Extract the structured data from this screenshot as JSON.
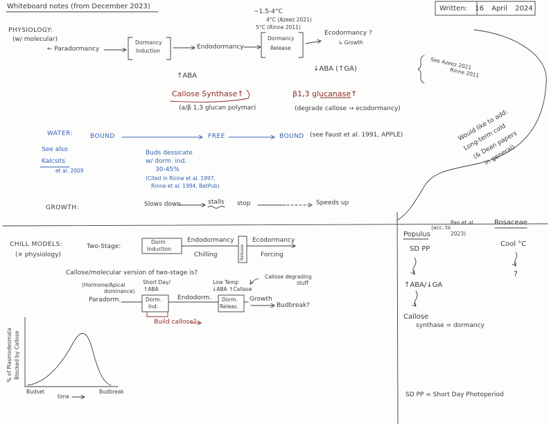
{
  "header": {
    "title": "Whiteboard notes (from December 2023)",
    "written": "Written: 16 April 2024"
  },
  "temps": {
    "range": "~1.5-4°C",
    "azeez": "4°C (Azeez 2021)",
    "rinne": "5°C (Rinne 2011)"
  },
  "physiology": {
    "label": "PHYSIOLOGY:",
    "sub": "(w/ molecular)",
    "paradormancy": "← Paradormancy",
    "induction_1": "Dormancy",
    "induction_2": "Induction",
    "endodormancy": "Endodormancy",
    "release_1": "Dormancy",
    "release_2": "Release",
    "ecodormancy": "Ecodormancy ?",
    "growth": "↳ Growth",
    "aba_up": "↑ABA",
    "aba_down": "↓ABA (↑GA)",
    "callose": "Callose Synthase↑",
    "callose_note": "(a/β 1,3 glucan polymar)",
    "glucanase": "β1,3 glucanase↑",
    "glucanase_note": "(degrade callose → ecodormancy)"
  },
  "refs": {
    "azeez": "See Azeez 2021",
    "rinne": "Rinne 2011"
  },
  "wishlist": {
    "line1": "Would like to add:",
    "line2": "Long-term cold",
    "line3": "(& Dean papers",
    "line4": "in general)"
  },
  "water": {
    "label": "WATER:",
    "bound1": "BOUND",
    "free": "FREE",
    "bound2": "BOUND",
    "faust": "(see Faust et al. 1991, APPLE)",
    "see_also": "See also",
    "kalcsits": "Kalcsits",
    "kalcsits_year": "et al. 2009",
    "buds_1": "Buds dessicate",
    "buds_2": "w/ dorm. ind.",
    "buds_3": "30-45%",
    "buds_4": "(Cited in Rinne et al. 1997,",
    "buds_5": "Rinne et al. 1994, BetPub)"
  },
  "growth": {
    "label": "GROWTH:",
    "slows": "Slows down",
    "stalls": "stalls",
    "stop": "stop",
    "speeds": "Speeds up"
  },
  "chill": {
    "label": "CHILL MODELS:",
    "sub": "(× physiology)",
    "two_stage": "Two-Stage:",
    "induction_1": "Dorm",
    "induction_2": "Induction",
    "endodormancy": "Endodormancy",
    "chilling": "Chilling",
    "release": "Release",
    "ecodormancy": "Ecodormancy",
    "forcing": "Forcing"
  },
  "molecular": {
    "question": "Callose/molecular version of two-stage is?",
    "hormone_1": "(Hormone/Apical",
    "hormone_2": "dominance)",
    "short_day_1": "Short Day/",
    "short_day_2": "↑ABA",
    "low_temp_1": "Low Temp",
    "low_temp_2": "↓ABA ↑Callase",
    "degrading_1": "Callose degrading",
    "degrading_2": "stuff",
    "paradorm": "Paradorm.",
    "dorm_ind_1": "Dorm.",
    "dorm_ind_2": "Ind.",
    "endodorm": "Endodorm.",
    "dorm_rel_1": "Dorm.",
    "dorm_rel_2": "Releas.",
    "growth": "Growth",
    "budbreak": "Budbreak?",
    "build": "Build callose?"
  },
  "sketch": {
    "ylabel_1": "% of Plasmodesmata",
    "ylabel_2": "Blocked by Callose",
    "x_start": "Budset",
    "x_label": "time",
    "x_end": "Budbreak"
  },
  "populus": {
    "title": "Populus",
    "ref_1": "(acc. to",
    "ref_2": "Pan et al.",
    "ref_3": "2023)",
    "sd": "SD PP",
    "hormones": "↑ABA/↓GA",
    "callose_1": "Callose",
    "callose_2": "synthase = dormancy"
  },
  "rosaceae": {
    "title": "Rosaceae",
    "cool": "Cool °C",
    "unknown": "?"
  },
  "footnote": "SD PP = Short Day Photoperiod",
  "colors": {
    "ink": "#3a3a3a",
    "blue": "#2f5fb3",
    "red": "#8a2b23"
  }
}
